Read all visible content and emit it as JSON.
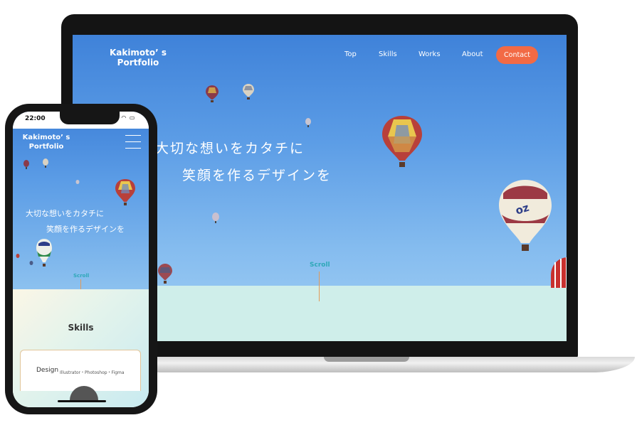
{
  "laptop_site": {
    "logo": [
      "Kakimoto’ s",
      "Portfolio"
    ],
    "nav": [
      "Top",
      "Skills",
      "Works",
      "About"
    ],
    "contact": "Contact",
    "hero_line1": "大切な想いをカタチに",
    "hero_line2": "笑顔を作るデザインを",
    "scroll": "Scroll"
  },
  "phone_site": {
    "status_time": "22:00",
    "logo": [
      "Kakimoto’ s",
      "Portfolio"
    ],
    "hero_line1": "大切な想いをカタチに",
    "hero_line2": "笑顔を作るデザインを",
    "scroll": "Scroll",
    "section_title": "Skills",
    "card_title": "Design",
    "card_tools": "Illustrator・Photoshop・Figma"
  },
  "colors": {
    "sky_top": "#3f82d9",
    "sky_bottom": "#a3d0f4",
    "contact_button": "#f26a45",
    "scroll_text": "#2ea8b8",
    "scroll_line": "#e29a58",
    "band": "#cfeeea"
  }
}
